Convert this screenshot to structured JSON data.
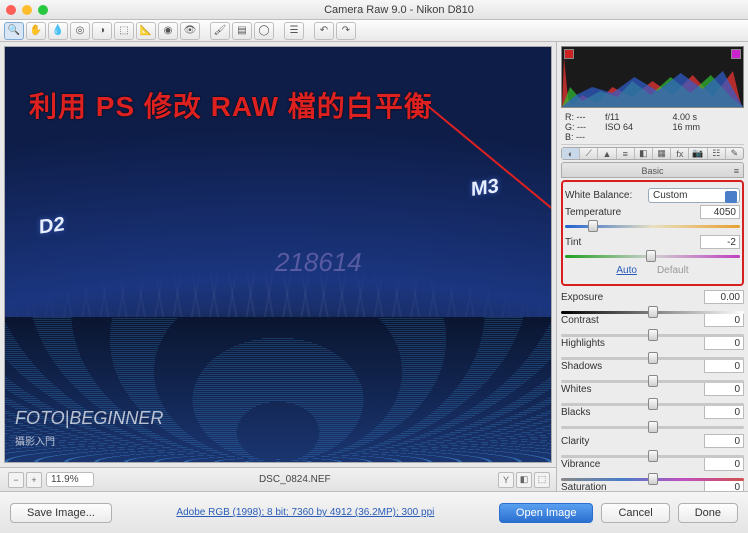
{
  "titlebar": {
    "title": "Camera Raw 9.0  -  Nikon D810"
  },
  "readout": {
    "r": "R:   ---",
    "g": "G:   ---",
    "b": "B:   ---",
    "aperture": "f/11",
    "shutter": "4.00 s",
    "iso": "ISO 64",
    "focal": "16 mm"
  },
  "panel": {
    "title": "Basic",
    "wb_label": "White Balance:",
    "wb_value": "Custom",
    "temp_label": "Temperature",
    "temp_value": "4050",
    "tint_label": "Tint",
    "tint_value": "-2",
    "auto": "Auto",
    "default": "Default",
    "exposure_label": "Exposure",
    "exposure_value": "0.00",
    "contrast_label": "Contrast",
    "contrast_value": "0",
    "highlights_label": "Highlights",
    "highlights_value": "0",
    "shadows_label": "Shadows",
    "shadows_value": "0",
    "whites_label": "Whites",
    "whites_value": "0",
    "blacks_label": "Blacks",
    "blacks_value": "0",
    "clarity_label": "Clarity",
    "clarity_value": "0",
    "vibrance_label": "Vibrance",
    "vibrance_value": "0",
    "saturation_label": "Saturation",
    "saturation_value": "0"
  },
  "leftbar": {
    "zoom": "11.9%",
    "filename": "DSC_0824.NEF"
  },
  "bottombar": {
    "save": "Save Image...",
    "meta": "Adobe RGB (1998); 8 bit; 7360 by 4912 (36.2MP); 300 ppi",
    "open": "Open Image",
    "cancel": "Cancel",
    "done": "Done"
  },
  "annotation": {
    "text": "利用 PS 修改 RAW 檔的白平衡",
    "watermark_num": "218614",
    "watermark_brand": "FOTO|BEGINNER",
    "watermark_brand_sub": "攝影入門",
    "sign_left": "D2",
    "sign_right": "M3"
  }
}
